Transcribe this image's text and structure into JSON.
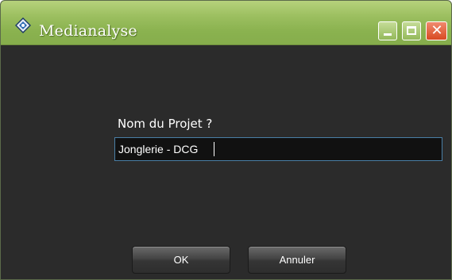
{
  "window": {
    "title": "Medianalyse",
    "controls": {
      "minimize": "minimize-icon",
      "maximize": "maximize-icon",
      "close": "close-icon"
    }
  },
  "dialog": {
    "prompt_label": "Nom du Projet ?",
    "project_name_value": "Jonglerie - DCG",
    "ok_label": "OK",
    "cancel_label": "Annuler"
  },
  "colors": {
    "titlebar": "#9cbf60",
    "background": "#2b2b2b",
    "input_border": "#4a7fa6",
    "close_button": "#d84a22"
  }
}
